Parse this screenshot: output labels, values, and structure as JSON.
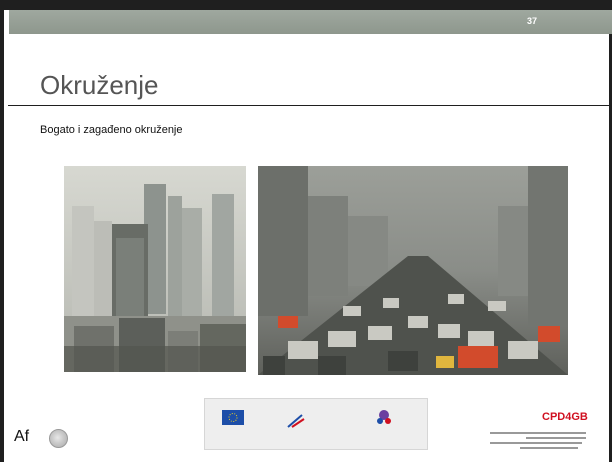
{
  "slide": {
    "number": "37",
    "title": "Okruženje",
    "subtitle": "Bogato i zagađeno okruženje"
  },
  "images": {
    "city": "smog-city-skyline",
    "traffic": "traffic-jam-smog"
  },
  "footer": {
    "left_text": "Af",
    "partner_name": "CPD4GB"
  },
  "icons": [
    "eu-flag-icon",
    "fund-logo-icon",
    "project-logo-icon",
    "partner-logo-icon"
  ],
  "colors": {
    "header_bar": "#949d93",
    "title_text": "#555555",
    "eu_blue": "#1d4ea8",
    "partner_red": "#d01020"
  }
}
